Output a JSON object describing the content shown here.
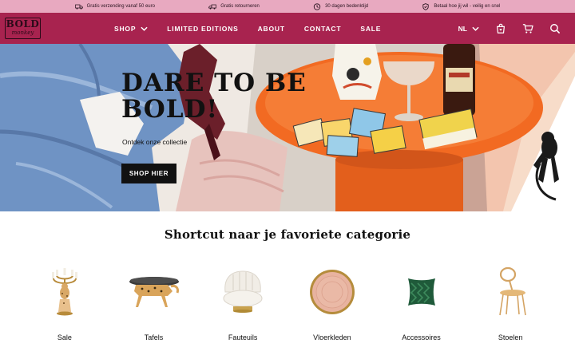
{
  "usp_bar": {
    "items": [
      {
        "icon": "truck-icon",
        "text": "Gratis verzending vanaf 50 euro"
      },
      {
        "icon": "return-truck-icon",
        "text": "Gratis retourneren"
      },
      {
        "icon": "clock-icon",
        "text": "30 dagen bedenktijd"
      },
      {
        "icon": "shield-icon",
        "text": "Betaal hoe jij wil - veilig en snel"
      }
    ]
  },
  "brand": {
    "line1": "BOLD",
    "line2": "monkey"
  },
  "nav": {
    "items": [
      "SHOP",
      "LIMITED EDITIONS",
      "ABOUT",
      "CONTACT",
      "SALE"
    ],
    "language": "NL"
  },
  "hero": {
    "headline_line1": "DARE TO BE",
    "headline_line2": "BOLD!",
    "subtitle": "Ontdek onze collectie",
    "cta": "SHOP HIER"
  },
  "categories": {
    "title": "Shortcut naar je favoriete categorie",
    "items": [
      {
        "label": "Sale",
        "icon": "candelabra"
      },
      {
        "label": "Tafels",
        "icon": "leopard-table"
      },
      {
        "label": "Fauteuils",
        "icon": "shell-chair"
      },
      {
        "label": "Vloerkleden",
        "icon": "round-rug"
      },
      {
        "label": "Accessoires",
        "icon": "cushion"
      },
      {
        "label": "Stoelen",
        "icon": "chair"
      }
    ]
  },
  "colors": {
    "brand": "#a8234f",
    "topbar": "#e8a9c0",
    "accent_orange": "#f26a22"
  }
}
